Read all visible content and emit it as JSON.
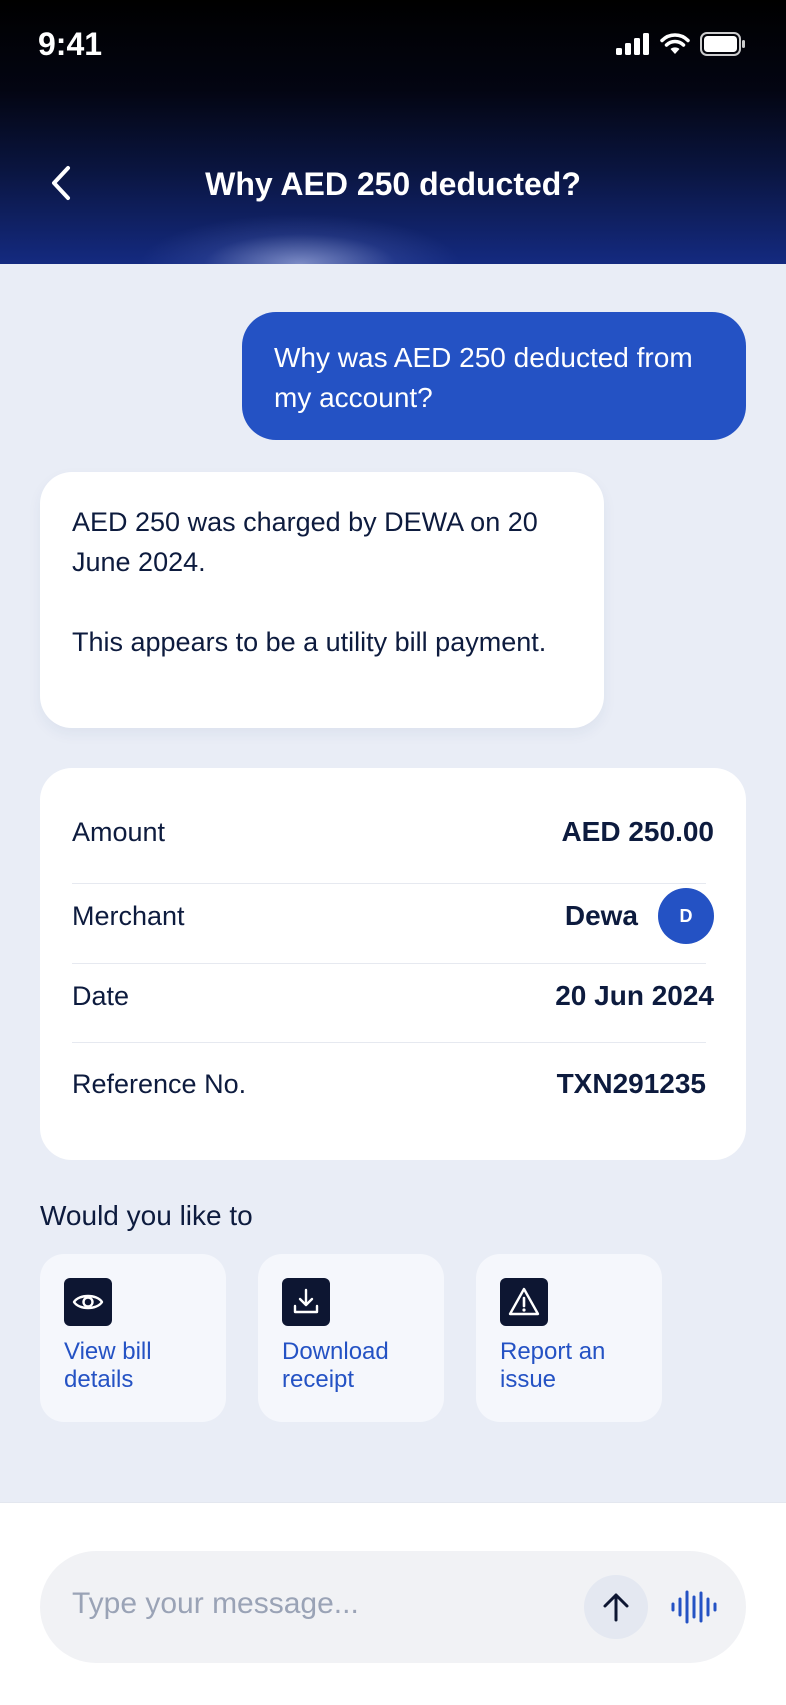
{
  "status": {
    "time": "9:41"
  },
  "header": {
    "title": "Why AED 250 deducted?"
  },
  "chat": {
    "user_message": "Why was AED 250 deducted from my account?",
    "bot_message_1": "AED 250 was charged by DEWA on 20 June 2024.",
    "bot_message_2": "This appears to be a utility bill payment."
  },
  "transaction": {
    "amount_label": "Amount",
    "amount_value": "AED 250.00",
    "merchant_label": "Merchant",
    "merchant_value": "Dewa",
    "merchant_initial": "D",
    "date_label": "Date",
    "date_value": "20 Jun 2024",
    "reference_label": "Reference No.",
    "reference_value": "TXN291235"
  },
  "actions": {
    "prompt": "Would you like to",
    "items": [
      {
        "label": "View bill details",
        "icon": "eye-icon"
      },
      {
        "label": "Download receipt",
        "icon": "download-icon"
      },
      {
        "label": "Report an issue",
        "icon": "warning-icon"
      }
    ]
  },
  "composer": {
    "placeholder": "Type your message..."
  },
  "colors": {
    "accent": "#2452c4",
    "icon_bg": "#0d1632",
    "page_bg": "#e9edf6"
  }
}
